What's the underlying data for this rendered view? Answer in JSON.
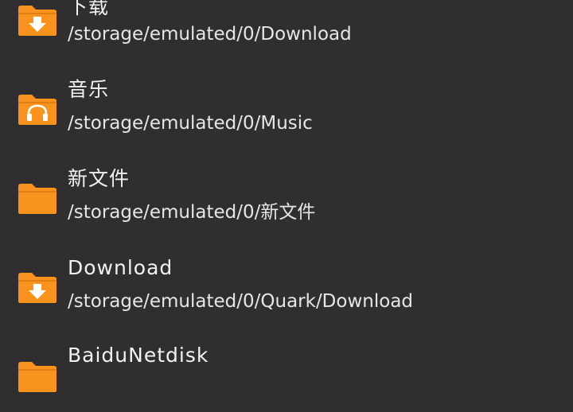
{
  "folders": [
    {
      "name": "下载",
      "path": "/storage/emulated/0/Download",
      "icon": "download-folder-icon"
    },
    {
      "name": "音乐",
      "path": "/storage/emulated/0/Music",
      "icon": "music-folder-icon"
    },
    {
      "name": "新文件",
      "path": "/storage/emulated/0/新文件",
      "icon": "folder-icon"
    },
    {
      "name": "Download",
      "path": "/storage/emulated/0/Quark/Download",
      "icon": "download-folder-icon"
    },
    {
      "name": "BaiduNetdisk",
      "path": "",
      "icon": "folder-icon"
    }
  ],
  "colors": {
    "background": "#302e31",
    "folder": "#f7931e",
    "text": "#f2f2f2"
  }
}
